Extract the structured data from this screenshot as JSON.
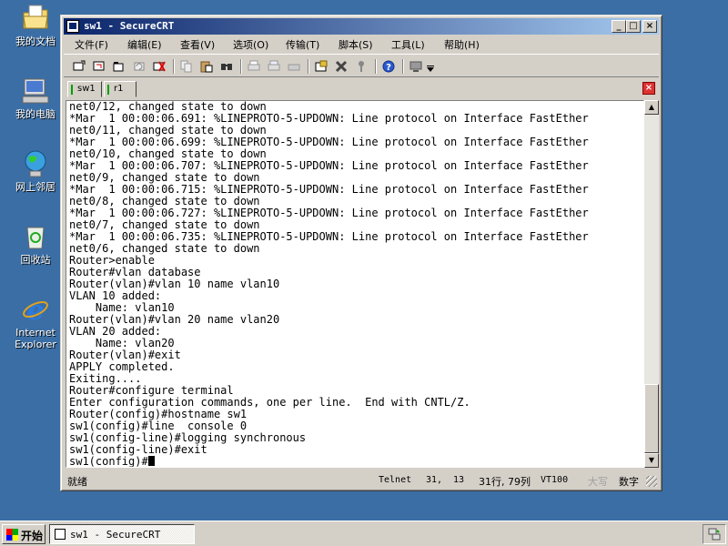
{
  "desktop": {
    "icons": [
      {
        "label": "我的文档"
      },
      {
        "label": "我的电脑"
      },
      {
        "label": "网上邻居"
      },
      {
        "label": "回收站"
      },
      {
        "label": "Internet Explorer"
      }
    ]
  },
  "window": {
    "title": "sw1 - SecureCRT",
    "controls": {
      "minimize": "_",
      "maximize": "□",
      "close": "×"
    }
  },
  "menu": [
    {
      "label": "文件(F)"
    },
    {
      "label": "编辑(E)"
    },
    {
      "label": "查看(V)"
    },
    {
      "label": "选项(O)"
    },
    {
      "label": "传输(T)"
    },
    {
      "label": "脚本(S)"
    },
    {
      "label": "工具(L)"
    },
    {
      "label": "帮助(H)"
    }
  ],
  "toolbar": {
    "icons": [
      "connect-icon",
      "quick-connect-icon",
      "connect-tab-icon",
      "reconnect-icon",
      "disconnect-icon",
      "copy-icon",
      "paste-icon",
      "find-icon",
      "print-icon",
      "print-setup-icon",
      "print-selection-icon",
      "session-options-icon",
      "global-options-icon",
      "keymap-icon",
      "help-icon",
      "monitor-icon",
      "dropdown-icon"
    ]
  },
  "tabs": [
    {
      "label": "sw1",
      "active": true
    },
    {
      "label": "r1",
      "active": false
    }
  ],
  "terminal": {
    "lines": [
      "net0/12, changed state to down",
      "*Mar  1 00:00:06.691: %LINEPROTO-5-UPDOWN: Line protocol on Interface FastEther",
      "net0/11, changed state to down",
      "*Mar  1 00:00:06.699: %LINEPROTO-5-UPDOWN: Line protocol on Interface FastEther",
      "net0/10, changed state to down",
      "*Mar  1 00:00:06.707: %LINEPROTO-5-UPDOWN: Line protocol on Interface FastEther",
      "net0/9, changed state to down",
      "*Mar  1 00:00:06.715: %LINEPROTO-5-UPDOWN: Line protocol on Interface FastEther",
      "net0/8, changed state to down",
      "*Mar  1 00:00:06.727: %LINEPROTO-5-UPDOWN: Line protocol on Interface FastEther",
      "net0/7, changed state to down",
      "*Mar  1 00:00:06.735: %LINEPROTO-5-UPDOWN: Line protocol on Interface FastEther",
      "net0/6, changed state to down",
      "Router>enable",
      "Router#vlan database",
      "Router(vlan)#vlan 10 name vlan10",
      "VLAN 10 added:",
      "    Name: vlan10",
      "Router(vlan)#vlan 20 name vlan20",
      "VLAN 20 added:",
      "    Name: vlan20",
      "Router(vlan)#exit",
      "APPLY completed.",
      "Exiting....",
      "Router#configure terminal",
      "Enter configuration commands, one per line.  End with CNTL/Z.",
      "Router(config)#hostname sw1",
      "sw1(config)#line  console 0",
      "sw1(config-line)#logging synchronous",
      "sw1(config-line)#exit"
    ],
    "prompt": "sw1(config)#"
  },
  "status": {
    "ready": "就绪",
    "protocol": "Telnet",
    "row": "31,",
    "col": "13",
    "position": "31行, 79列",
    "emulation": "VT100",
    "caps": "大写",
    "num": "数字"
  },
  "taskbar": {
    "start_label": "开始",
    "task_label": "sw1 - SecureCRT"
  },
  "colors": {
    "desktop": "#3a6ea5",
    "titlebar_start": "#0a246a",
    "titlebar_end": "#a6caf0",
    "chrome": "#d4d0c8"
  }
}
